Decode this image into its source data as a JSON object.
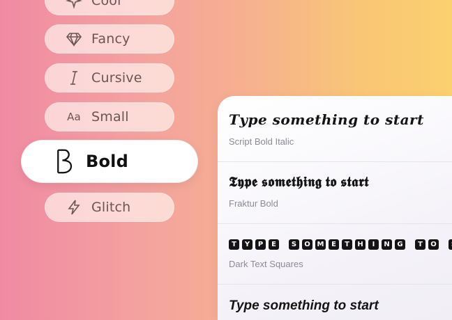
{
  "menu": {
    "items": [
      {
        "label": "Cool",
        "icon": "sparkle-icon"
      },
      {
        "label": "Fancy",
        "icon": "diamond-icon"
      },
      {
        "label": "Cursive",
        "icon": "italic-i-icon"
      },
      {
        "label": "Small",
        "icon": "aa-icon",
        "icon_text": "Aa"
      },
      {
        "label": "Bold",
        "icon": "bold-b-icon",
        "active": true
      },
      {
        "label": "Glitch",
        "icon": "lightning-icon"
      }
    ]
  },
  "results": [
    {
      "sample": "𝑻𝒚𝒑𝒆 𝒔𝒐𝒎𝒆𝒕𝒉𝒊𝒏𝒈 𝒕𝒐 𝒔𝒕𝒂𝒓𝒕",
      "caption": "Script Bold Italic"
    },
    {
      "sample": "𝕿𝖞𝖕𝖊 𝖘𝖔𝖒𝖊𝖙𝖍𝖎𝖓𝖌 𝖙𝖔 𝖘𝖙𝖆𝖗𝖙",
      "caption": "Fraktur Bold"
    },
    {
      "sample": "TYPE SOMETHING TO S",
      "caption": "Dark Text Squares"
    },
    {
      "sample": "Type something to start",
      "caption": ""
    }
  ]
}
